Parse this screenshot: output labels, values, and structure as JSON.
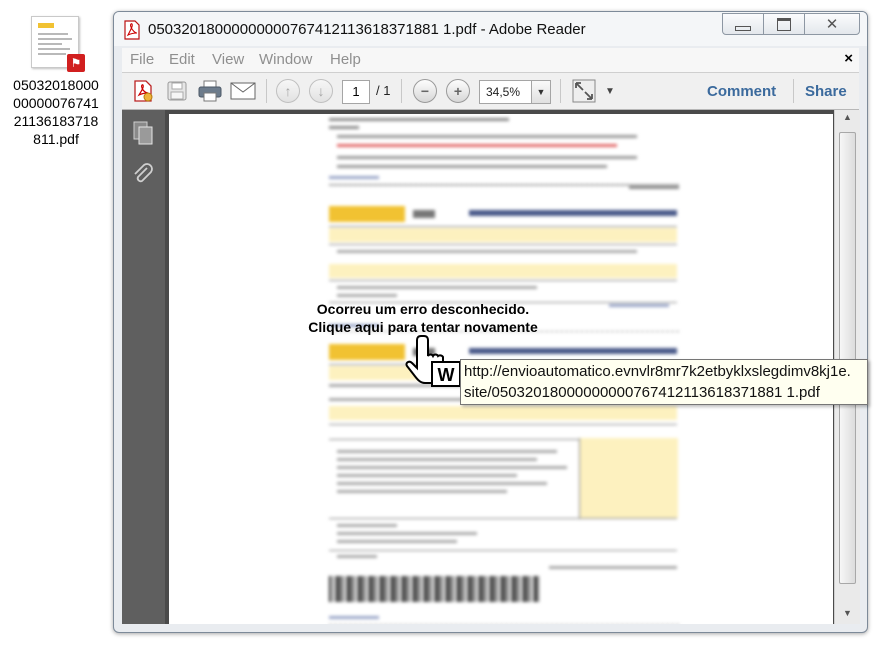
{
  "desktop": {
    "file_label": "05032018000000000767412113618371881 1.pdf",
    "icon": "pdf-file-icon"
  },
  "window": {
    "title": "05032018000000000767412113618371881 1.pdf - Adobe Reader",
    "buttons": {
      "minimize": "minimize-icon",
      "maximize": "maximize-icon",
      "close": "close-icon"
    }
  },
  "menu": {
    "items": [
      "File",
      "Edit",
      "View",
      "Window",
      "Help"
    ],
    "close_glyph": "×"
  },
  "toolbar": {
    "page_current": "1",
    "page_total": "/ 1",
    "zoom": "34,5%",
    "comment_label": "Comment",
    "share_label": "Share"
  },
  "overlay": {
    "error_line1": "Ocorreu um erro desconhecido.",
    "error_line2": "Clique aqui para tentar novamente",
    "tooltip_line1": "http://envioautomatico.evnvlr8mr7k2etbyklxslegdimv8kj1e.",
    "tooltip_line2": "site/05032018000000000767412113618371881 1.pdf"
  },
  "colors": {
    "accent_link": "#3b6a9d",
    "pdf_red": "#d11f1f",
    "boleto_yellow": "#f1c232"
  }
}
